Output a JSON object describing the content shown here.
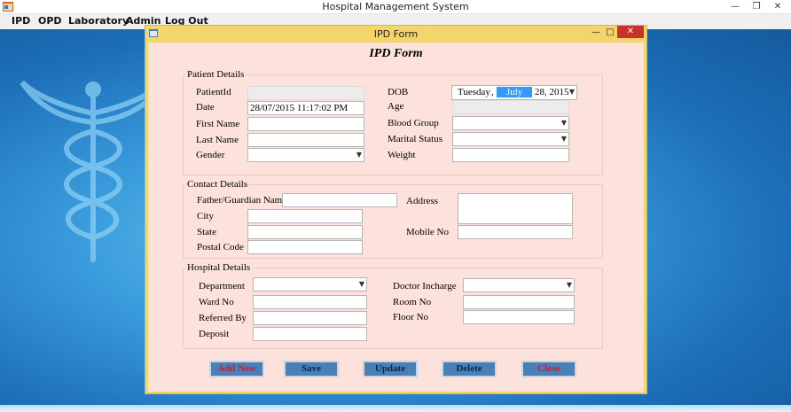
{
  "app": {
    "title": "Hospital Management System",
    "menu": [
      "IPD",
      "OPD",
      "Laboratory",
      "Admin",
      "Log Out"
    ]
  },
  "form": {
    "window_title": "IPD Form",
    "heading": "IPD Form",
    "patient": {
      "group_title": "Patient Details",
      "patientid_label": "PatientId",
      "patientid_value": "",
      "date_label": "Date",
      "date_value": "28/07/2015 11:17:02 PM",
      "firstname_label": "First Name",
      "lastname_label": "Last Name",
      "gender_label": "Gender",
      "dob_label": "DOB",
      "dob_weekday": "Tuesday",
      "dob_sep": ",",
      "dob_month": "July",
      "dob_dayyear": "28, 2015",
      "age_label": "Age",
      "bloodgroup_label": "Blood Group",
      "marital_label": "Marital Status",
      "weight_label": "Weight"
    },
    "contact": {
      "group_title": "Contact Details",
      "guardian_label": "Father/Guardian Name",
      "city_label": "City",
      "state_label": "State",
      "postal_label": "Postal Code",
      "address_label": "Address",
      "mobile_label": "Mobile No"
    },
    "hospital": {
      "group_title": "Hospital Details",
      "department_label": "Department",
      "ward_label": "Ward No",
      "referred_label": "Referred By",
      "deposit_label": "Deposit",
      "doctor_label": "Doctor Incharge",
      "room_label": "Room No",
      "floor_label": "Floor No"
    },
    "buttons": {
      "add_new": "Add New",
      "save": "Save",
      "update": "Update",
      "delete": "Delete",
      "close": "Close"
    }
  },
  "colors": {
    "form_background": "#fde2dc",
    "window_frame": "#f3d56a",
    "button_fill": "#4a80b8",
    "accent_red": "#d01d2e",
    "selection_blue": "#3399ff"
  },
  "icons": [
    "app-icon",
    "minimize-icon",
    "restore-icon",
    "close-icon",
    "caduceus-logo",
    "chevron-down-icon"
  ]
}
